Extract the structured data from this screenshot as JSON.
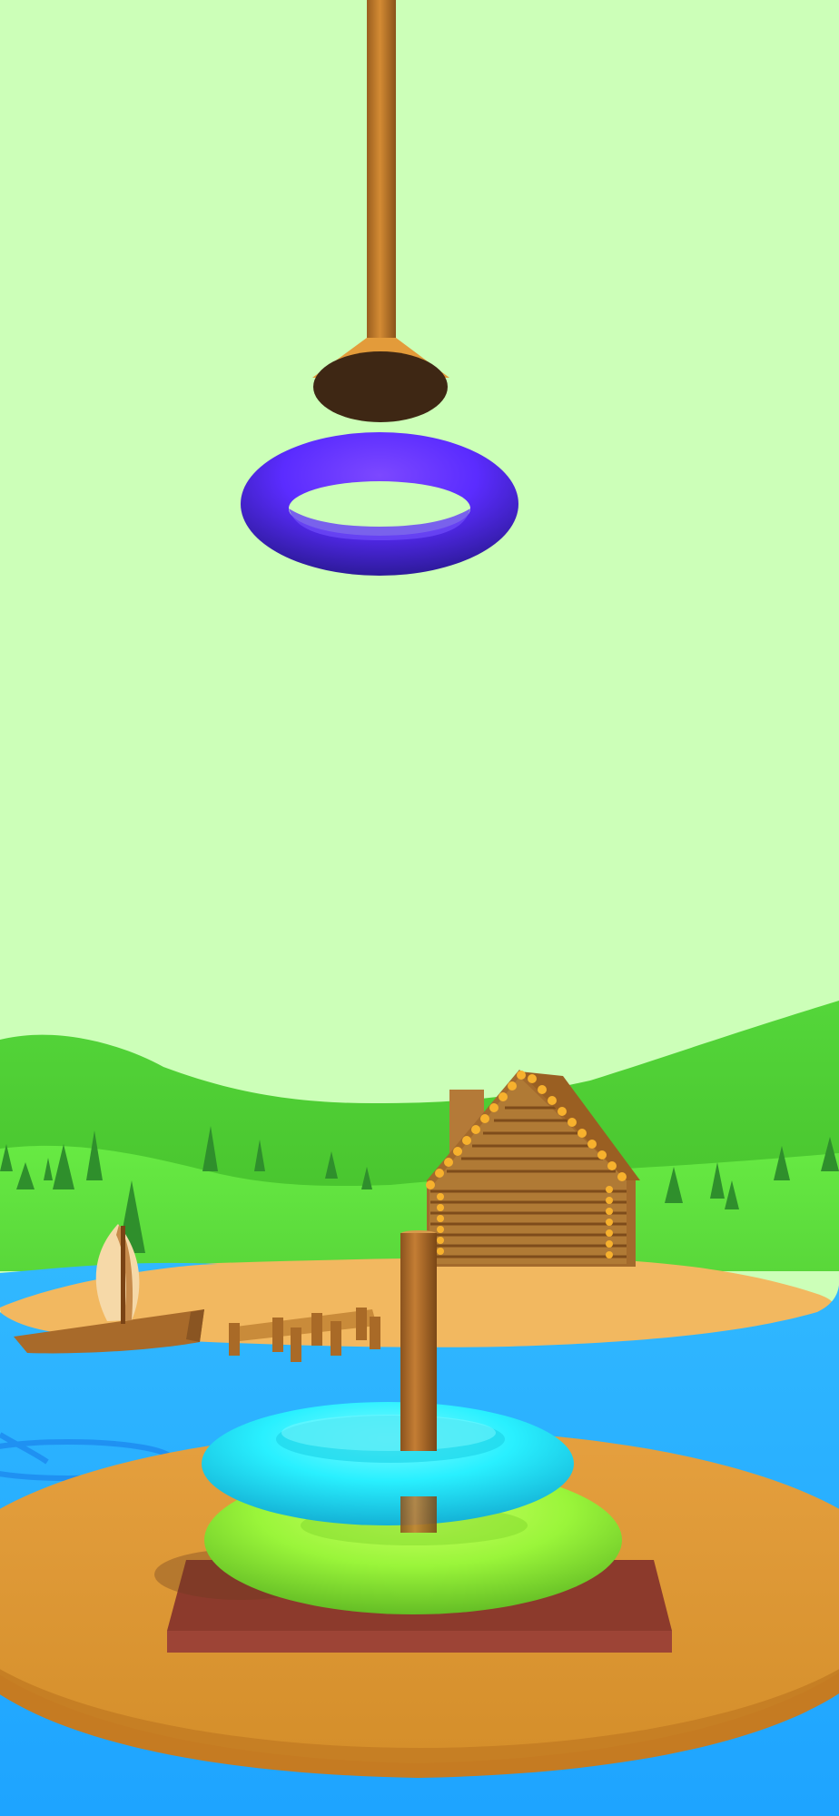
{
  "app": {
    "title": "",
    "hud_text": ""
  },
  "scene": {
    "palette": {
      "sky": "#CCFFB8",
      "rope": "#C9822E",
      "hook_top": "#E39B3A",
      "hook_bottom": "#3E2714",
      "hills_far": "#4FD13A",
      "hills_near": "#5EE83E",
      "trees": "#2F8F2C",
      "sand": "#F2B860",
      "water": "#29B6FF",
      "wood": "#A86A2A",
      "log_cabin": "#B07A35",
      "roof_knots": "#F7B12D",
      "platform": "#E29B38",
      "platform_rim": "#C67F24",
      "base_block": "#8C3A2C",
      "pole": "#B8732D"
    },
    "rings": [
      {
        "name": "held-ring",
        "color": "#5B2CFF",
        "state": "held"
      },
      {
        "name": "top-stacked-ring",
        "color": "#29F0FF",
        "state": "stacked"
      },
      {
        "name": "bottom-stacked-ring",
        "color": "#9AF53A",
        "state": "stacked"
      }
    ],
    "stack": {
      "rings_on_pole": 2
    }
  }
}
